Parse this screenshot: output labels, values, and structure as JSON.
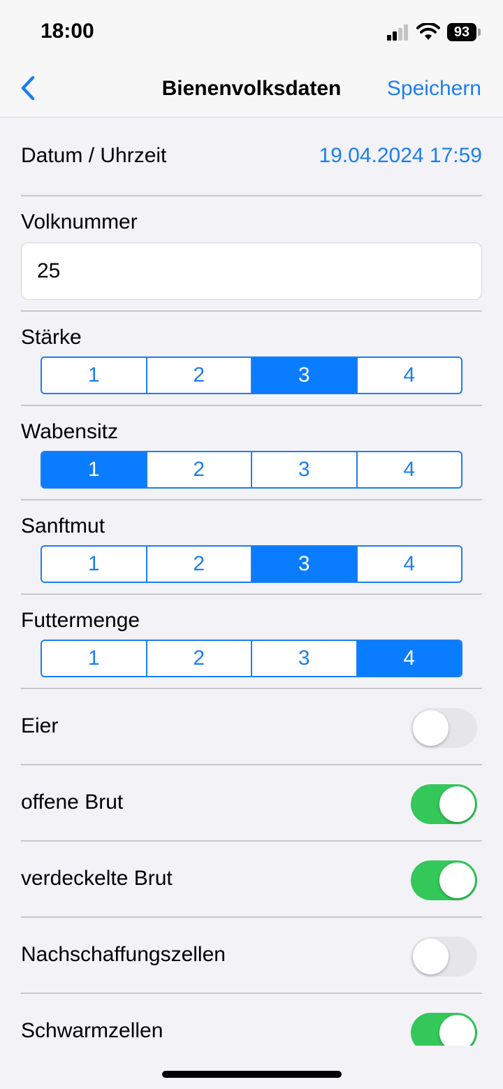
{
  "status": {
    "time": "18:00",
    "battery": "93"
  },
  "nav": {
    "title": "Bienenvolksdaten",
    "save_label": "Speichern"
  },
  "date": {
    "label": "Datum / Uhrzeit",
    "value": "19.04.2024 17:59"
  },
  "volk": {
    "label": "Volknummer",
    "value": "25"
  },
  "segments": [
    {
      "label": "Stärke",
      "options": [
        "1",
        "2",
        "3",
        "4"
      ],
      "selected": 2
    },
    {
      "label": "Wabensitz",
      "options": [
        "1",
        "2",
        "3",
        "4"
      ],
      "selected": 0
    },
    {
      "label": "Sanftmut",
      "options": [
        "1",
        "2",
        "3",
        "4"
      ],
      "selected": 2
    },
    {
      "label": "Futtermenge",
      "options": [
        "1",
        "2",
        "3",
        "4"
      ],
      "selected": 3
    }
  ],
  "toggles": [
    {
      "label": "Eier",
      "on": false
    },
    {
      "label": "offene Brut",
      "on": true
    },
    {
      "label": "verdeckelte Brut",
      "on": true
    },
    {
      "label": "Nachschaffungszellen",
      "on": false
    },
    {
      "label": "Schwarmzellen",
      "on": true
    }
  ],
  "colors": {
    "accent": "#1c7ef2",
    "segment_selected": "#0a7cff",
    "toggle_on": "#34c759",
    "toggle_off": "#e6e6ea",
    "background": "#f2f2f7"
  },
  "icons": {
    "back": "chevron-left-icon",
    "signal": "cellular-signal-icon",
    "wifi": "wifi-icon",
    "battery": "battery-icon"
  }
}
